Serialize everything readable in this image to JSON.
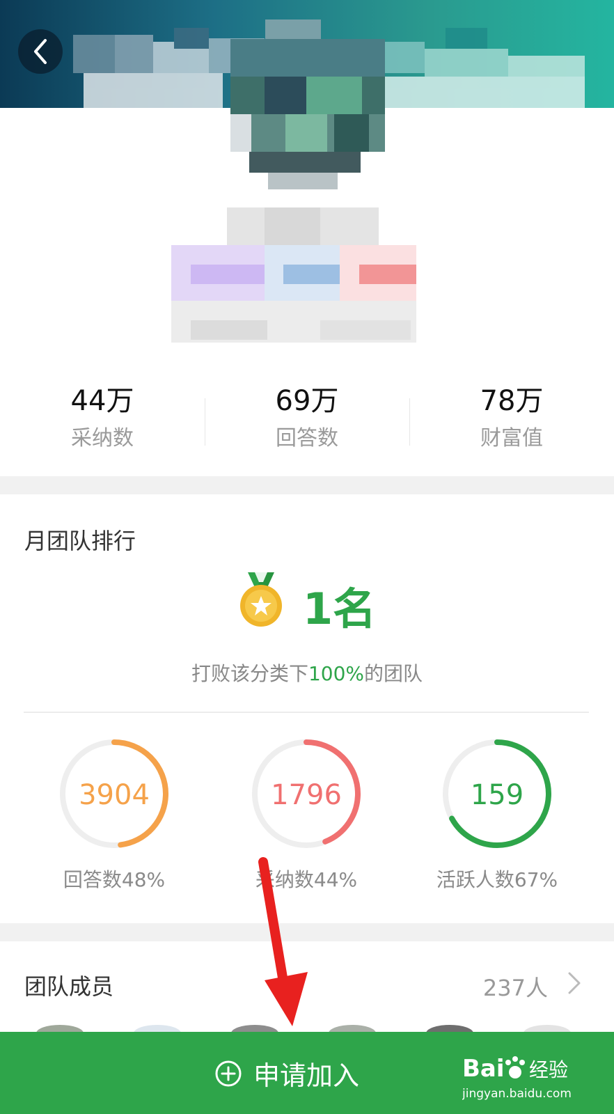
{
  "stats": [
    {
      "value": "44万",
      "label": "采纳数"
    },
    {
      "value": "69万",
      "label": "回答数"
    },
    {
      "value": "78万",
      "label": "财富值"
    }
  ],
  "ranking": {
    "title": "月团队排行",
    "rank": "1名",
    "subtitle_prefix": "打败该分类下",
    "subtitle_percent": "100%",
    "subtitle_suffix": "的团队",
    "medal_icon": "medal-icon"
  },
  "rings": [
    {
      "value": "3904",
      "label": "回答数48%",
      "fraction": 0.48,
      "color": "#f5a24a"
    },
    {
      "value": "1796",
      "label": "采纳数44%",
      "fraction": 0.44,
      "color": "#f07070"
    },
    {
      "value": "159",
      "label": "活跃人数67%",
      "fraction": 0.67,
      "color": "#2ea54a"
    }
  ],
  "members": {
    "title": "团队成员",
    "count": "237人"
  },
  "join_button": {
    "label": "申请加入"
  },
  "watermark": {
    "line1": "Bai",
    "line2": "经验",
    "line3": "jingyan.baidu.com"
  },
  "colors": {
    "accent_green": "#2ea54a",
    "ring_track": "#eeeeee",
    "arrow_red": "#e8211f"
  }
}
